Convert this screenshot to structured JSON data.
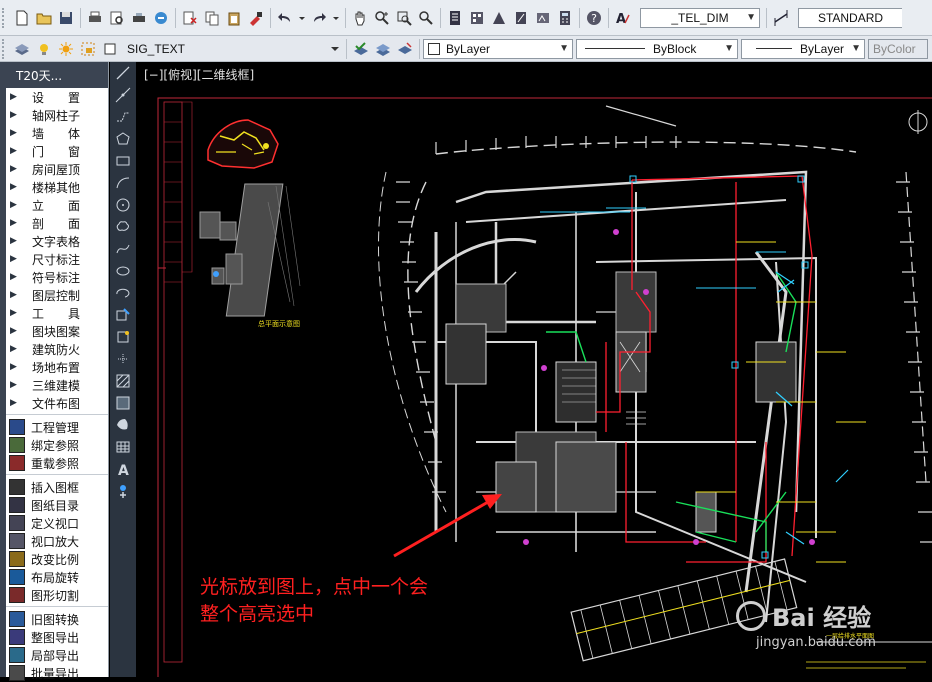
{
  "toolbar1": {
    "text_style": "_TEL_DIM",
    "dim_style": "STANDARD"
  },
  "toolbar2": {
    "layer": "SIG_TEXT",
    "color": "ByLayer",
    "linetype": "ByBlock",
    "lineweight": "ByLayer",
    "plotstyle": "ByColor"
  },
  "palette": {
    "title": "T20天...",
    "groups": [
      "设　　置",
      "轴网柱子",
      "墙　　体",
      "门　　窗",
      "房间屋顶",
      "楼梯其他",
      "立　　面",
      "剖　　面",
      "文字表格",
      "尺寸标注",
      "符号标注",
      "图层控制",
      "工　　具",
      "图块图案",
      "建筑防火",
      "场地布置",
      "三维建模",
      "文件布图"
    ],
    "tools": [
      "工程管理",
      "绑定参照",
      "重载参照",
      "插入图框",
      "图纸目录",
      "定义视口",
      "视口放大",
      "改变比例",
      "布局旋转",
      "图形切割",
      "旧图转换",
      "整图导出",
      "局部导出",
      "批量导出"
    ]
  },
  "canvas": {
    "viewport_label": "[−][俯视][二维线框]",
    "annotation_line1": "光标放到图上，点中一个会",
    "annotation_line2": "整个高亮选中",
    "watermark_main": "Bai 经验",
    "watermark_sub": "jingyan.baidu.com",
    "small_plan_caption": "总平面示意图",
    "main_caption": "一层给排水平面图"
  },
  "colors": {
    "annotation": "#ff2020",
    "frame_red": "#c0283a",
    "plan_white": "#d8d8d8",
    "pipe_green": "#19e05a",
    "pipe_magenta": "#d040d0",
    "label_yellow": "#f0e020"
  }
}
